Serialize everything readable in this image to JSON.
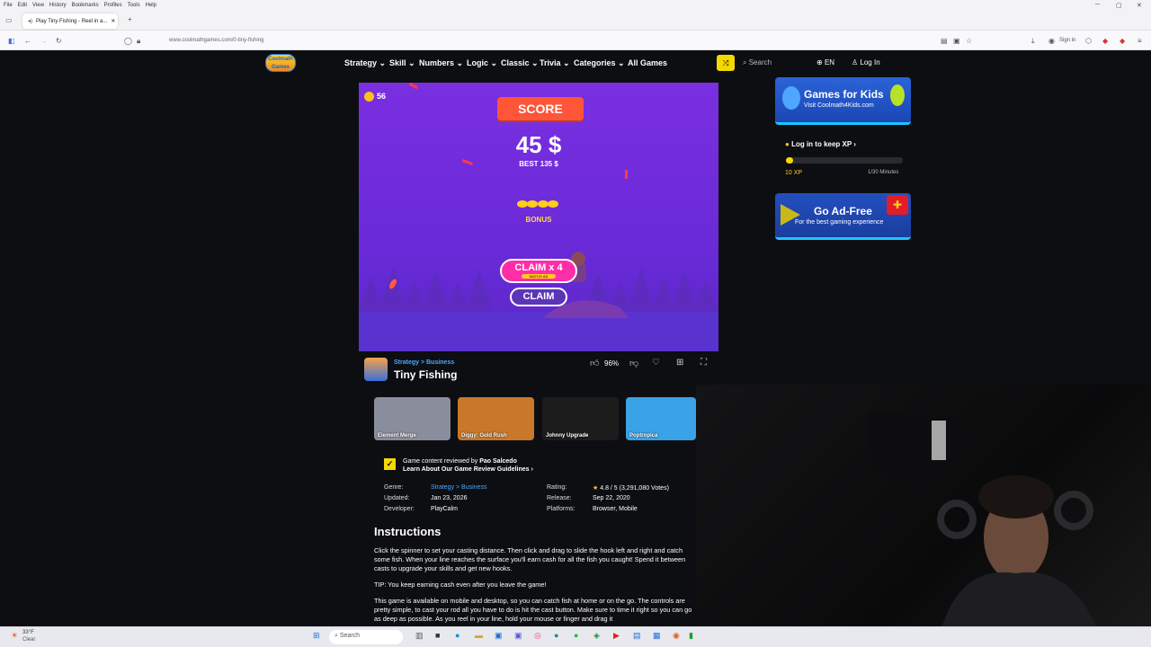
{
  "browser": {
    "menu": [
      "File",
      "Edit",
      "View",
      "History",
      "Bookmarks",
      "Profiles",
      "Tools",
      "Help"
    ],
    "tab_title": "Play Tiny Fishing - Reel in a...",
    "url": "www.coolmathgames.com/0-tiny-fishing",
    "sign_in": "Sign in"
  },
  "site": {
    "logo_top": "Coolmath",
    "logo_bottom": "Games",
    "nav": [
      "Strategy",
      "Skill",
      "Numbers",
      "Logic",
      "Classic",
      "Trivia",
      "Categories",
      "All Games"
    ],
    "search_placeholder": "Search",
    "lang": "EN",
    "login": "Log In"
  },
  "game": {
    "coins": "56",
    "score_label": "SCORE",
    "score": "45 $",
    "best": "BEST 135 $",
    "bonus_label": "BONUS",
    "claim_x4": "CLAIM x 4",
    "watch_ad": "WATCH AD",
    "claim": "CLAIM"
  },
  "info": {
    "breadcrumb": "Strategy > Business",
    "title": "Tiny Fishing",
    "like_pct": "96%"
  },
  "related": [
    {
      "name": "Element Merge",
      "color": "#8a8d9c"
    },
    {
      "name": "Diggy: Gold Rush",
      "color": "#c9782a"
    },
    {
      "name": "Johnny Upgrade",
      "color": "#1c1c1c"
    },
    {
      "name": "Poptropica",
      "color": "#3aa2e6"
    }
  ],
  "review": {
    "line1_prefix": "Game content reviewed by",
    "reviewer": "Pao Salcedo",
    "line2": "Learn About Our Game Review Guidelines",
    "chev": "›"
  },
  "meta": {
    "genre_label": "Genre:",
    "genre": "Strategy > Business",
    "updated_label": "Updated:",
    "updated": "Jan 23, 2026",
    "developer_label": "Developer:",
    "developer": "PlayCalm",
    "rating_label": "Rating:",
    "rating": "4.8 / 5  (3,291,080 Votes)",
    "release_label": "Release:",
    "release": "Sep 22, 2020",
    "platforms_label": "Platforms:",
    "platforms": "Browser, Mobile"
  },
  "instructions": {
    "heading": "Instructions",
    "p1": "Click the spinner to set your casting distance. Then click and drag to slide the hook left and right and catch some fish. When your line reaches the surface you'll earn cash for all the fish you caught! Spend it between casts to upgrade your skills and get new hooks.",
    "p2": "TIP: You keep earning cash even after you leave the game!",
    "p3": "This game is available on mobile and desktop, so you can catch fish at home or on the go. The controls are pretty simple, to cast your rod all you have to do is hit the cast button. Make sure to time it right so you can go as deep as possible. As you reel in your line, hold your mouse or finger and drag it"
  },
  "sidebar": {
    "kids_title": "Games for Kids",
    "kids_sub": "Visit Coolmath4Kids.com",
    "xp_prompt": "Log in to keep XP",
    "xp_value": "10 XP",
    "xp_minutes": "1/30 Minutes",
    "xp_fraction": 0.03,
    "adfree_title": "Go Ad-Free",
    "adfree_sub": "For the best gaming experience"
  },
  "taskbar": {
    "weather_temp": "33°F",
    "weather_text": "Clear",
    "search": "Search"
  }
}
